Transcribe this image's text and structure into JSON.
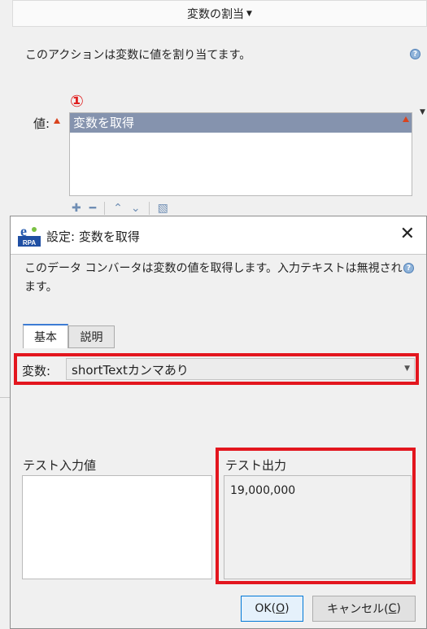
{
  "background_window": {
    "title": "変数の割当",
    "description": "このアクションは変数に値を割り当てます。",
    "annotation_marker": "①",
    "value_label": "値:",
    "value_list": [
      "変数を取得"
    ]
  },
  "dialog": {
    "title": "設定: 変数を取得",
    "app_icon_letter": "e",
    "app_icon_text": "RPA",
    "close_symbol": "✕",
    "description": "このデータ コンバータは変数の値を取得します。入力テキストは無視されます。",
    "tabs": [
      {
        "label": "基本",
        "selected": true
      },
      {
        "label": "説明",
        "selected": false
      }
    ],
    "variable": {
      "label": "変数:",
      "selected_value": "shortTextカンマあり"
    },
    "test_input": {
      "label": "テスト入力値",
      "value": ""
    },
    "test_output": {
      "label": "テスト出力",
      "value": "19,000,000"
    },
    "buttons": {
      "ok": {
        "label": "OK(",
        "mnemonic": "O",
        "suffix": ")"
      },
      "cancel": {
        "label": "キャンセル(",
        "mnemonic": "C",
        "suffix": ")"
      }
    }
  },
  "colors": {
    "highlight_red": "#e3161e",
    "list_selection": "#8593ae",
    "ok_border": "#0078d7"
  },
  "icons": [
    "help-icon",
    "warning-icon",
    "add-icon",
    "remove-icon",
    "move-up-icon",
    "move-down-icon",
    "edit-icon",
    "close-icon",
    "chevron-down-icon"
  ]
}
